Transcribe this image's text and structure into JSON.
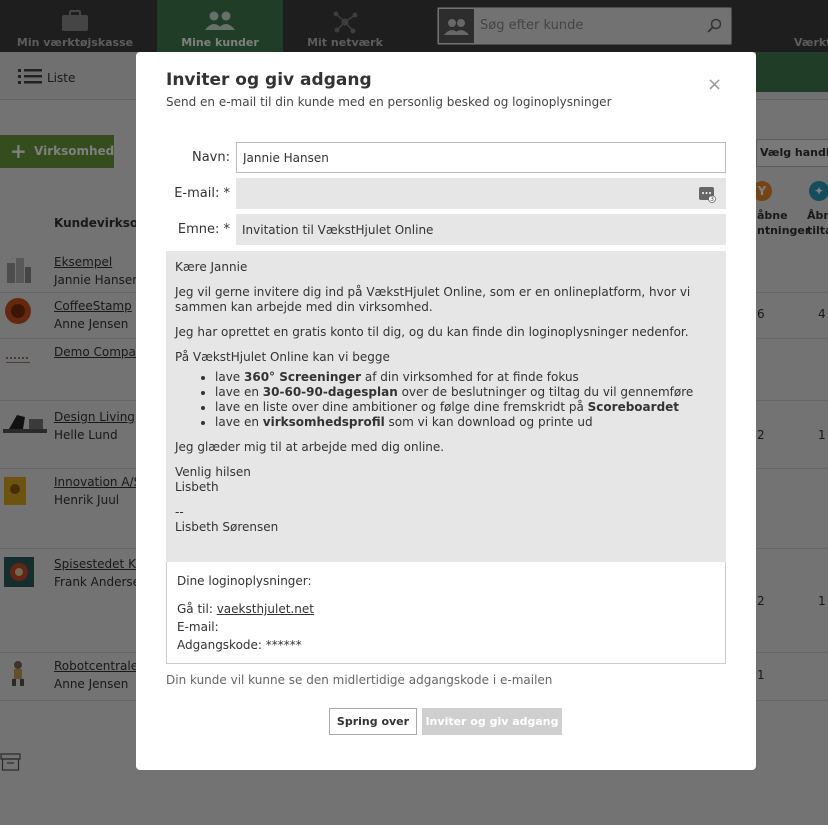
{
  "topnav": {
    "tabs": [
      {
        "label": "Min værktøjskasse",
        "icon": "briefcase-icon"
      },
      {
        "label": "Mine kunder",
        "icon": "people-icon",
        "active": true
      },
      {
        "label": "Mit netværk",
        "icon": "network-icon"
      }
    ],
    "search_placeholder": "Søg efter kunde",
    "right_label": "Værkt"
  },
  "subbar": {
    "list_label": "Liste"
  },
  "actions": {
    "add_company": "Virksomhed",
    "choose_action": "Vælg handlin"
  },
  "table": {
    "col_company": "Kundevirksom",
    "col_open_actions": [
      "åbne",
      "ntninger"
    ],
    "col_open_initiatives": [
      "Åbn",
      "tilta"
    ],
    "rows": [
      {
        "company": "Eksempel",
        "person": "Jannie Hansen",
        "n1": "",
        "n2": ""
      },
      {
        "company": "CoffeeStamp",
        "person": "Anne Jensen",
        "n1": "6",
        "n2": "4"
      },
      {
        "company": "Demo Compan",
        "person": "",
        "n1": "",
        "n2": ""
      },
      {
        "company": "Design Living",
        "person": "Helle Lund",
        "n1": "2",
        "n2": "1"
      },
      {
        "company": "Innovation A/S",
        "person": "Henrik Juul",
        "n1": "",
        "n2": ""
      },
      {
        "company": "Spisestedet KE",
        "person": "Frank Andersen",
        "n1": "2",
        "n2": "1"
      },
      {
        "company": "Robotcentrale",
        "person": "Anne Jensen",
        "n1": "1",
        "n2": ""
      }
    ]
  },
  "modal": {
    "title": "Inviter og giv adgang",
    "subtitle": "Send en e-mail til din kunde med en personlig besked og loginoplysninger",
    "close_symbol": "×",
    "fields": {
      "name_label": "Navn:",
      "name_value": "Jannie Hansen",
      "email_label": "E-mail: *",
      "email_value": "",
      "subject_label": "Emne: *",
      "subject_value": "Invitation til VækstHjulet Online"
    },
    "message": {
      "greeting": "Kære Jannie",
      "p1": "Jeg vil gerne invitere dig ind på VækstHjulet Online, som er en onlineplatform, hvor vi sammen kan arbejde med din virksomhed.",
      "p2": "Jeg har oprettet en gratis konto til dig, og du kan finde din loginoplysninger nedenfor.",
      "p3": "På VækstHjulet Online kan vi begge",
      "bullets": [
        {
          "pre": "lave ",
          "bold": "360° Screeninger",
          "post": " af din virksomhed for at finde fokus"
        },
        {
          "pre": "lave en ",
          "bold": "30-60-90-dagesplan",
          "post": " over de beslutninger og tiltag du vil gennemføre"
        },
        {
          "pre": "lave en liste over dine ambitioner og følge dine fremskridt på ",
          "bold": "Scoreboardet",
          "post": ""
        },
        {
          "pre": "lave en ",
          "bold": "virksomhedsprofil",
          "post": " som vi kan download og printe ud"
        }
      ],
      "p4": "Jeg glæder mig til at arbejde med dig online.",
      "closing": "Venlig hilsen",
      "signer": "Lisbeth",
      "sep": "--",
      "full_name": "Lisbeth Sørensen"
    },
    "login": {
      "heading": "Dine loginoplysninger:",
      "goto_label": "Gå til: ",
      "goto_link": "vaeksthjulet.net",
      "email_label": "E-mail:",
      "password_label": "Adgangskode: ******"
    },
    "note": "Din kunde vil kunne se den midlertidige adgangskode i e-mailen",
    "skip_button": "Spring over",
    "invite_button": "Inviter og giv adgang"
  },
  "colors": {
    "accent_green": "#3e7a4f",
    "add_green": "#6a9a3a",
    "orange": "#e8892a",
    "teal": "#2a9ab8"
  }
}
